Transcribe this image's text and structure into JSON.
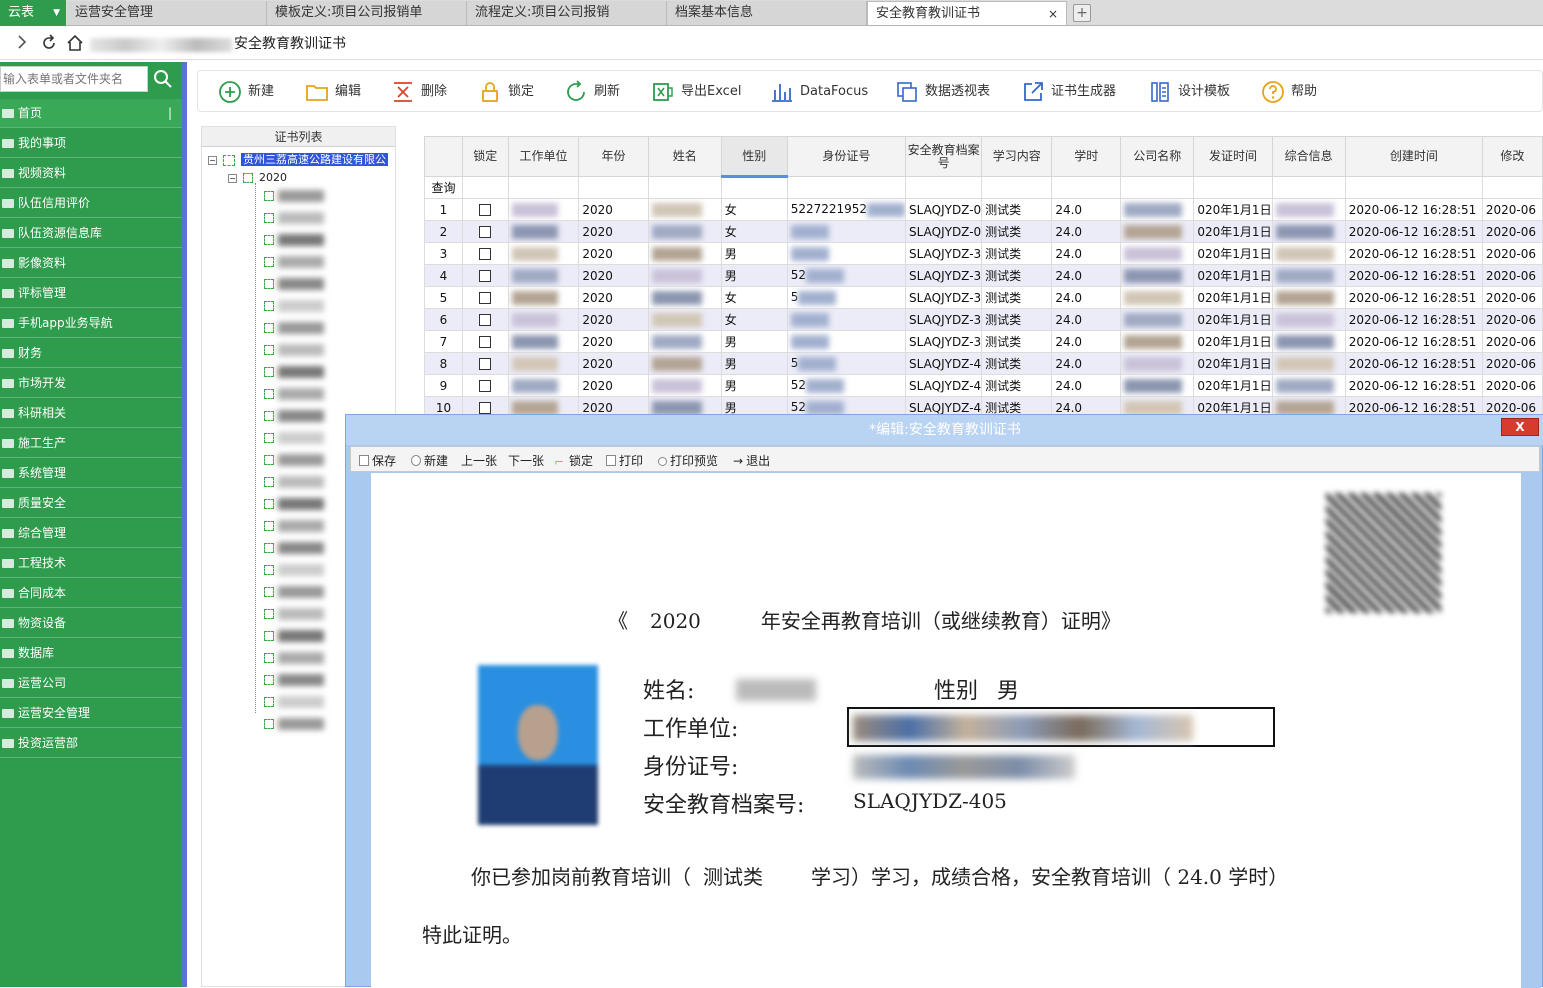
{
  "brand": {
    "label": "云表"
  },
  "tabs": [
    {
      "label": "运营安全管理"
    },
    {
      "label": "模板定义:项目公司报销单"
    },
    {
      "label": "流程定义:项目公司报销"
    },
    {
      "label": "档案基本信息"
    },
    {
      "label": "安全教育教训证书",
      "close": "×"
    }
  ],
  "addressbar": {
    "title": "安全教育教训证书"
  },
  "sidebar": {
    "search_placeholder": "输入表单或者文件夹名",
    "items": [
      {
        "label": "首页"
      },
      {
        "label": "我的事项"
      },
      {
        "label": "视频资料"
      },
      {
        "label": "队伍信用评价"
      },
      {
        "label": "队伍资源信息库"
      },
      {
        "label": "影像资料"
      },
      {
        "label": "评标管理"
      },
      {
        "label": "手机app业务导航"
      },
      {
        "label": "财务"
      },
      {
        "label": "市场开发"
      },
      {
        "label": "科研相关"
      },
      {
        "label": "施工生产"
      },
      {
        "label": "系统管理"
      },
      {
        "label": "质量安全"
      },
      {
        "label": "综合管理"
      },
      {
        "label": "工程技术"
      },
      {
        "label": "合同成本"
      },
      {
        "label": "物资设备"
      },
      {
        "label": "数据库"
      },
      {
        "label": "运营公司"
      },
      {
        "label": "运营安全管理"
      },
      {
        "label": "投资运营部"
      }
    ]
  },
  "toolbar": {
    "new": "新建",
    "edit": "编辑",
    "delete": "删除",
    "lock": "锁定",
    "refresh": "刷新",
    "export_excel": "导出Excel",
    "datafocus": "DataFocus",
    "pivot": "数据透视表",
    "cert_generator": "证书生成器",
    "design_template": "设计模板",
    "help": "帮助"
  },
  "tree": {
    "header": "证书列表",
    "root": "贵州三荔高速公路建设有限公",
    "year": "2020"
  },
  "grid": {
    "columns": [
      "锁定",
      "工作单位",
      "年份",
      "姓名",
      "性别",
      "身份证号",
      "安全教育档案号",
      "学习内容",
      "学时",
      "公司名称",
      "发证时间",
      "综合信息",
      "创建时间",
      "修改"
    ],
    "query_label": "查询",
    "rows": [
      {
        "n": "1",
        "year": "2020",
        "gender": "女",
        "id": "5227221952",
        "file": "SLAQJYDZ-0",
        "content": "测试类",
        "hours": "24.0",
        "issued": "020年1月1日",
        "created": "2020-06-12 16:28:51",
        "modified": "2020-06"
      },
      {
        "n": "2",
        "year": "2020",
        "gender": "女",
        "id": "",
        "file": "SLAQJYDZ-0",
        "content": "测试类",
        "hours": "24.0",
        "issued": "020年1月1日",
        "created": "2020-06-12 16:28:51",
        "modified": "2020-06"
      },
      {
        "n": "3",
        "year": "2020",
        "gender": "男",
        "id": "",
        "file": "SLAQJYDZ-3",
        "content": "测试类",
        "hours": "24.0",
        "issued": "020年1月1日",
        "created": "2020-06-12 16:28:51",
        "modified": "2020-06"
      },
      {
        "n": "4",
        "year": "2020",
        "gender": "男",
        "id": "52",
        "file": "SLAQJYDZ-3",
        "content": "测试类",
        "hours": "24.0",
        "issued": "020年1月1日",
        "created": "2020-06-12 16:28:51",
        "modified": "2020-06"
      },
      {
        "n": "5",
        "year": "2020",
        "gender": "女",
        "id": "5",
        "file": "SLAQJYDZ-3",
        "content": "测试类",
        "hours": "24.0",
        "issued": "020年1月1日",
        "created": "2020-06-12 16:28:51",
        "modified": "2020-06"
      },
      {
        "n": "6",
        "year": "2020",
        "gender": "女",
        "id": "",
        "file": "SLAQJYDZ-3",
        "content": "测试类",
        "hours": "24.0",
        "issued": "020年1月1日",
        "created": "2020-06-12 16:28:51",
        "modified": "2020-06"
      },
      {
        "n": "7",
        "year": "2020",
        "gender": "男",
        "id": "",
        "file": "SLAQJYDZ-3",
        "content": "测试类",
        "hours": "24.0",
        "issued": "020年1月1日",
        "created": "2020-06-12 16:28:51",
        "modified": "2020-06"
      },
      {
        "n": "8",
        "year": "2020",
        "gender": "男",
        "id": "5",
        "file": "SLAQJYDZ-4",
        "content": "测试类",
        "hours": "24.0",
        "issued": "020年1月1日",
        "created": "2020-06-12 16:28:51",
        "modified": "2020-06"
      },
      {
        "n": "9",
        "year": "2020",
        "gender": "男",
        "id": "52",
        "file": "SLAQJYDZ-4",
        "content": "测试类",
        "hours": "24.0",
        "issued": "020年1月1日",
        "created": "2020-06-12 16:28:51",
        "modified": "2020-06"
      },
      {
        "n": "10",
        "year": "2020",
        "gender": "男",
        "id": "52",
        "file": "SLAQJYDZ-4",
        "content": "测试类",
        "hours": "24.0",
        "issued": "020年1月1日",
        "created": "2020-06-12 16:28:51",
        "modified": "2020-06"
      }
    ]
  },
  "dialog": {
    "title": "*编辑:安全教育教训证书",
    "close": "X",
    "toolbar": {
      "save": "保存",
      "new": "新建",
      "prev": "上一张",
      "next": "下一张",
      "lock": "锁定",
      "print": "打印",
      "print_preview": "打印预览",
      "exit": "退出"
    },
    "certificate": {
      "title_open": "《",
      "year": "2020",
      "title_rest": "年安全再教育培训（或继续教育）证明》",
      "name_label": "姓名:",
      "gender_label": "性别",
      "gender_value": "男",
      "unit_label": "工作单位:",
      "id_label": "身份证号:",
      "file_label": "安全教育档案号:",
      "file_value": "SLAQJYDZ-405",
      "para1_a": "你已参加岗前教育培训（",
      "para1_content": "测试类",
      "para1_b": "学习）学习，成绩合格，安全教育培训（ 24.0 学时）",
      "para2": "特此证明。"
    }
  }
}
